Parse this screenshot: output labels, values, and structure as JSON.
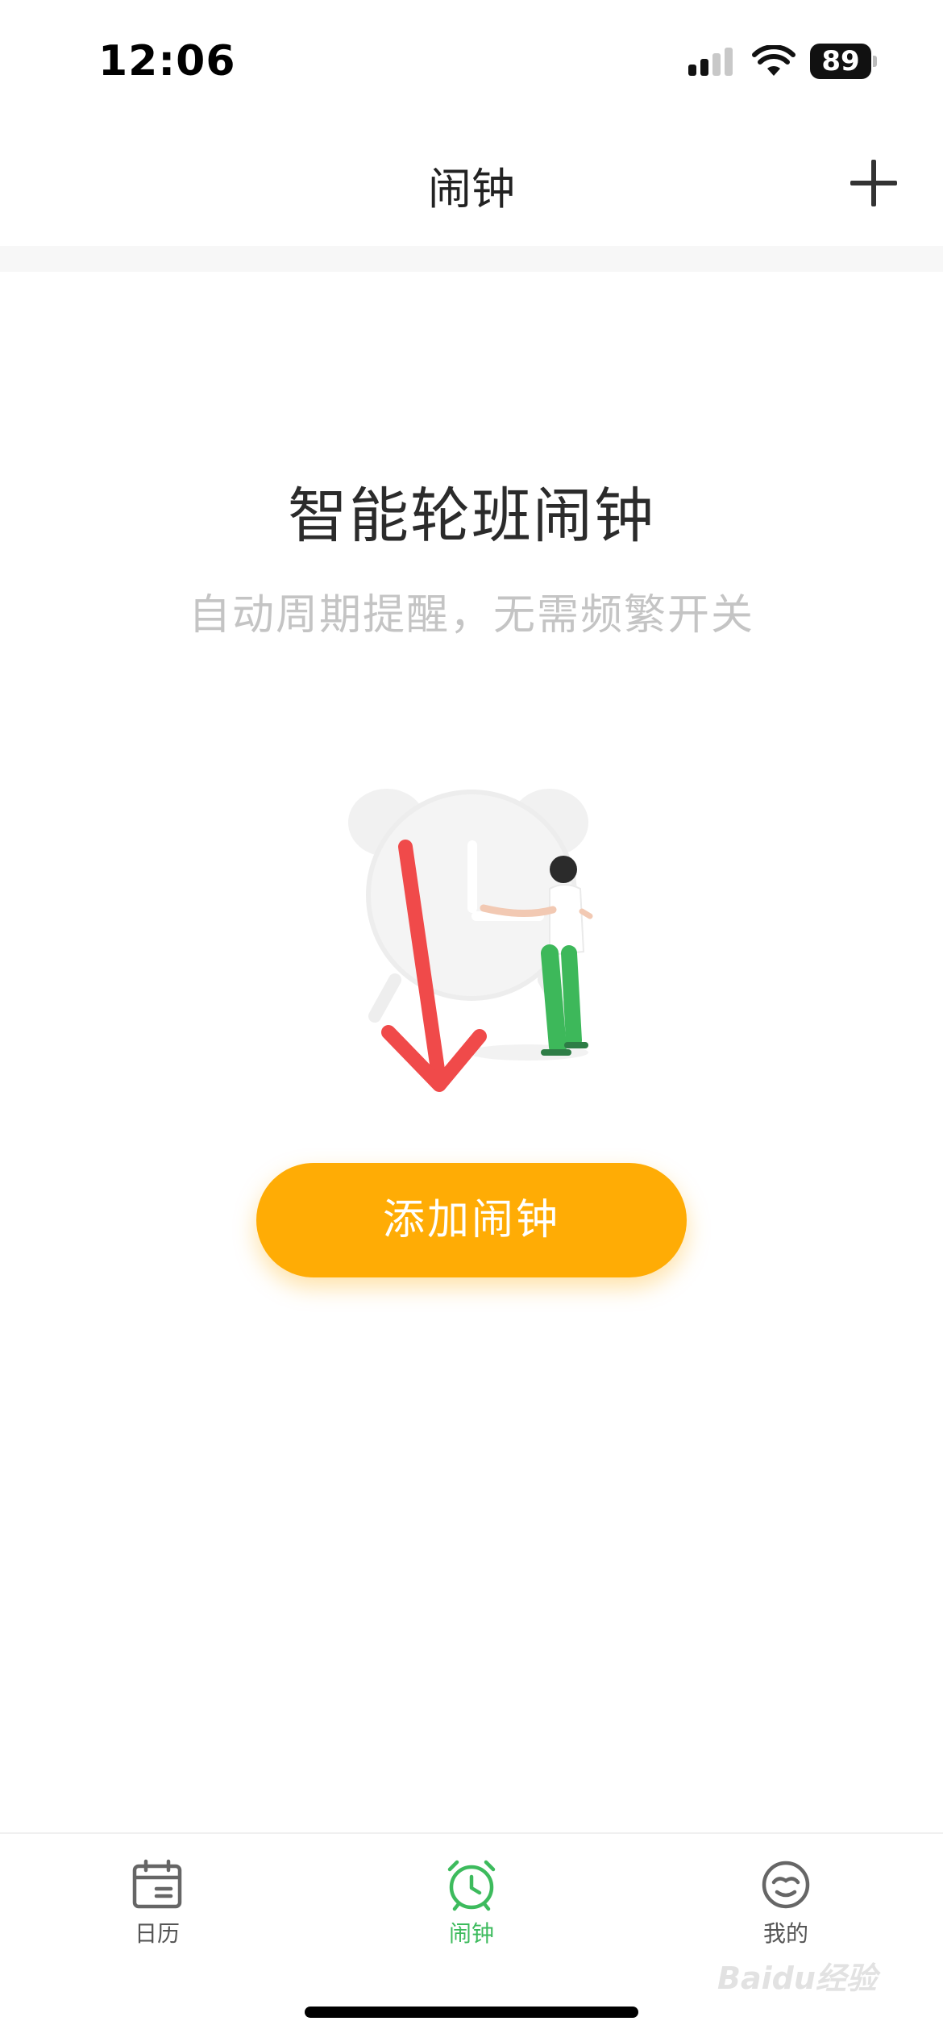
{
  "status_bar": {
    "time": "12:06",
    "battery": "89",
    "icons": [
      "cellular-signal-icon",
      "wifi-icon",
      "battery-icon"
    ]
  },
  "header": {
    "title": "闹钟",
    "add_icon": "plus-icon"
  },
  "empty_state": {
    "title": "智能轮班闹钟",
    "subtitle": "自动周期提醒，无需频繁开关",
    "illustration": "alarm-clock-with-person-illustration",
    "annotation": "red-down-arrow",
    "button_label": "添加闹钟"
  },
  "tab_bar": {
    "tabs": [
      {
        "label": "日历",
        "icon": "calendar-icon",
        "active": false
      },
      {
        "label": "闹钟",
        "icon": "alarm-clock-icon",
        "active": true
      },
      {
        "label": "我的",
        "icon": "profile-face-icon",
        "active": false
      }
    ]
  },
  "watermark": "Baidu经验",
  "colors": {
    "accent_button": "#ffac05",
    "active_tab": "#3dbb5d",
    "annotation_arrow": "#f04a4a",
    "subtitle": "#c4c4c4"
  }
}
